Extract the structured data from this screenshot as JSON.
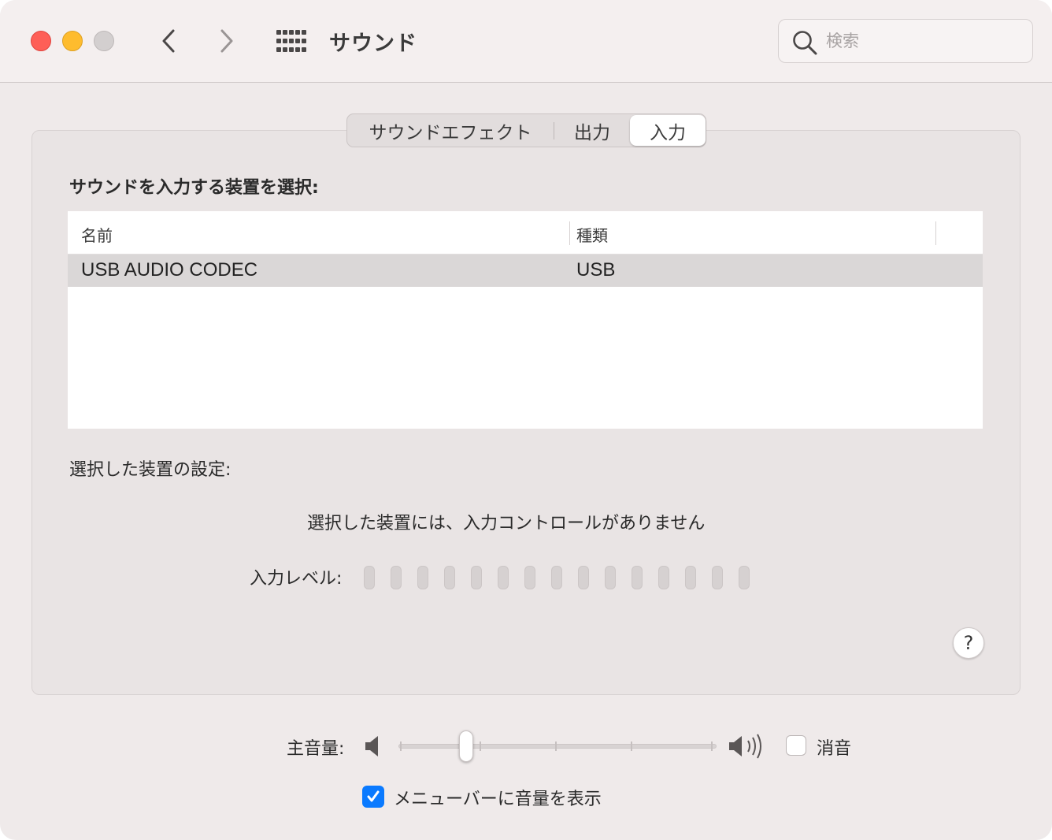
{
  "window": {
    "title": "サウンド"
  },
  "toolbar": {
    "back_icon": "chevron-left-icon",
    "forward_icon": "chevron-right-icon",
    "show_all_icon": "grid-icon"
  },
  "search": {
    "placeholder": "検索",
    "value": ""
  },
  "tabs": [
    {
      "label": "サウンドエフェクト",
      "selected": false
    },
    {
      "label": "出力",
      "selected": false
    },
    {
      "label": "入力",
      "selected": true
    }
  ],
  "input": {
    "section_title": "サウンドを入力する装置を選択:",
    "table": {
      "columns": [
        "名前",
        "種類"
      ],
      "rows": [
        {
          "name": "USB AUDIO  CODEC",
          "type": "USB",
          "selected": true
        }
      ]
    },
    "settings_title": "選択した装置の設定:",
    "no_controls_message": "選択した装置には、入力コントロールがありません",
    "level_label": "入力レベル:",
    "level_segments": 15,
    "level_active_segments": 0
  },
  "help": {
    "label": "?"
  },
  "volume": {
    "label": "主音量:",
    "level_fraction": 0.2,
    "mute_label": "消音",
    "mute_checked": false,
    "menubar_label": "メニューバーに音量を表示",
    "menubar_checked": true
  },
  "colors": {
    "accent": "#0a7aff",
    "close": "#fe5f57",
    "minimize": "#febc2e",
    "zoom_inactive": "#d3cfcf",
    "selected_row": "#dad7d7"
  }
}
